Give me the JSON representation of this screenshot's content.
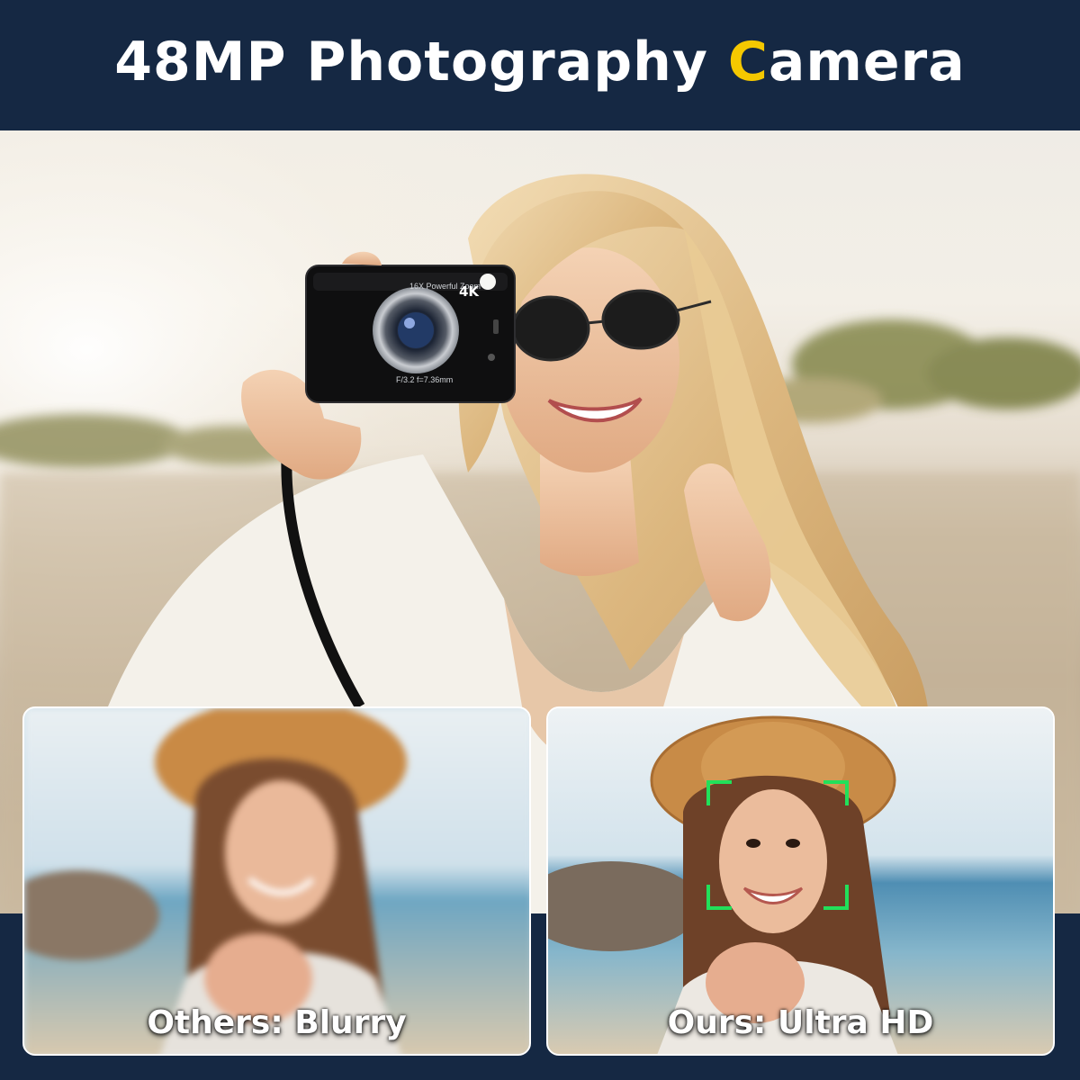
{
  "header": {
    "title_prefix": "48MP Photography ",
    "title_accent": "C",
    "title_suffix": "amera"
  },
  "camera": {
    "resolution_badge": "4K",
    "lens_text_top": "16X Powerful Zoom",
    "lens_text_bottom": "F/3.2 f=7.36mm"
  },
  "comparison": {
    "left_caption": "Others: Blurry",
    "right_caption": "Ours: Ultra HD"
  },
  "colors": {
    "navy": "#152843",
    "accent_yellow": "#f5c800",
    "focus_green": "#22e05a"
  }
}
